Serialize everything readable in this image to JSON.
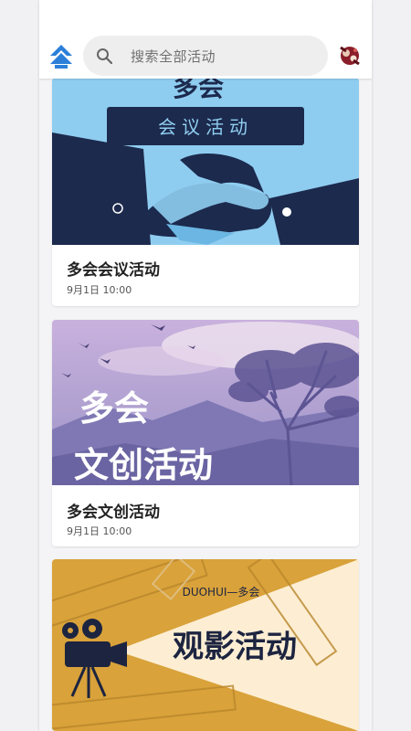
{
  "search": {
    "placeholder": "搜索全部活动"
  },
  "cards": [
    {
      "title": "多会会议活动",
      "date": "9月1日 10:00",
      "banner_top_text": "多会",
      "banner_label": "会议活动"
    },
    {
      "title": "多会文创活动",
      "date": "9月1日 10:00",
      "banner_line1": "多会",
      "banner_line2": "文创活动"
    },
    {
      "banner_sub": "DUOHUI—多会",
      "banner_title": "观影活动"
    }
  ],
  "colors": {
    "accent_blue": "#2b7fd9",
    "meeting_bg": "#8fcdf0",
    "meeting_navy": "#1c2a4d",
    "culture_purple": "#8b7ab8",
    "film_yellow": "#d9a23a"
  },
  "icons": [
    "logo-icon",
    "search-icon",
    "avatar-icon"
  ]
}
